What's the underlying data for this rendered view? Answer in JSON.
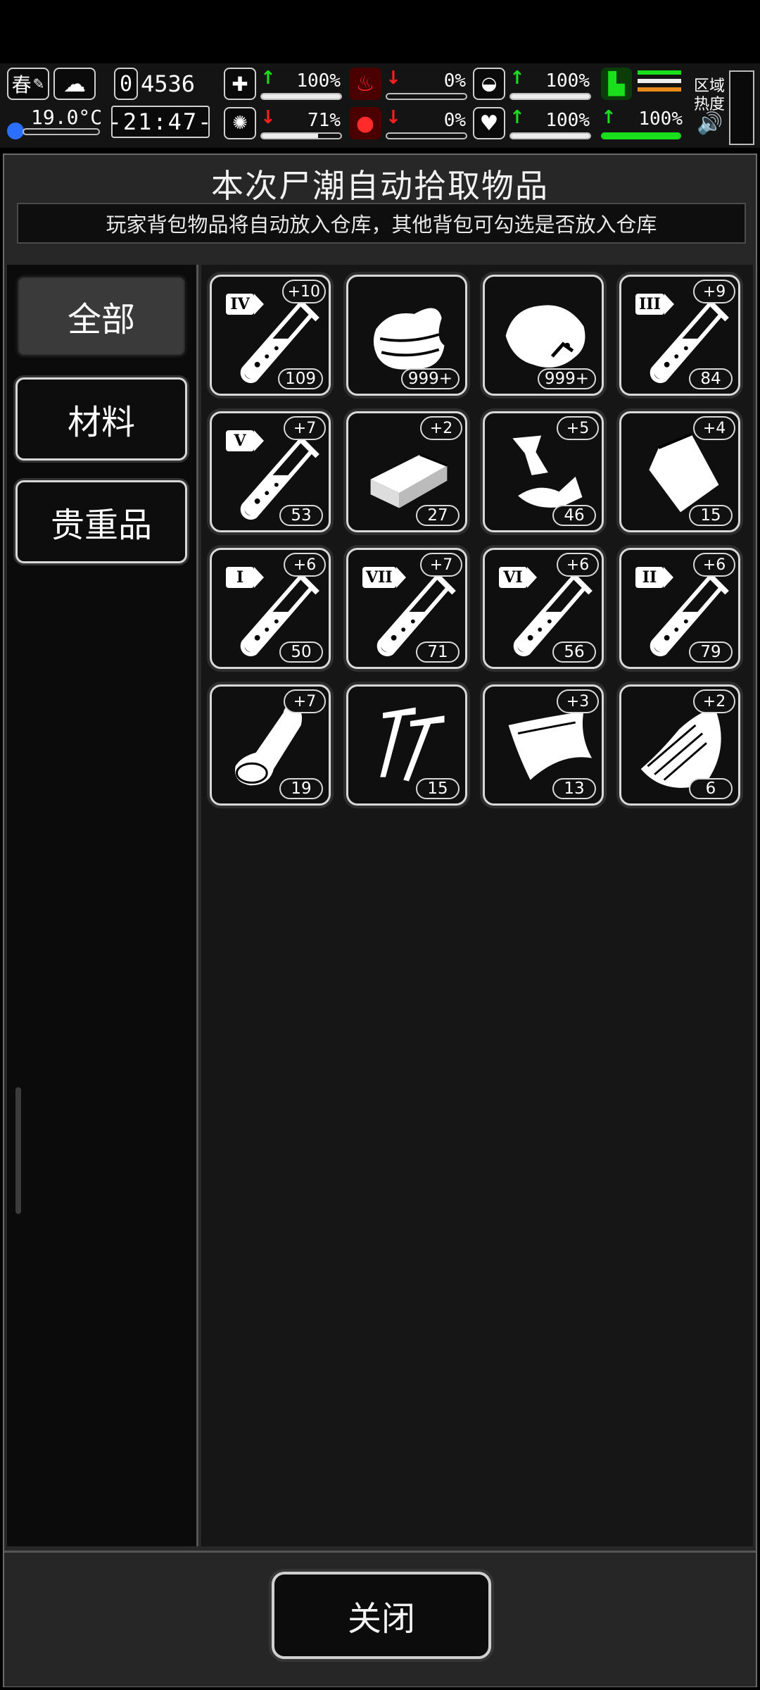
{
  "hud": {
    "season": "春",
    "temperature": "19.0°C",
    "day_counter": "4536",
    "day_digit": "0",
    "clock": "-21:47-",
    "region_heat_label_1": "区域",
    "region_heat_label_2": "热度",
    "stats": [
      {
        "icon": "medkit-icon",
        "trend": "up",
        "value": "100%"
      },
      {
        "icon": "stomach-icon",
        "trend": "down",
        "value": "0%"
      },
      {
        "icon": "pill-icon",
        "trend": "up",
        "value": "100%"
      },
      {
        "icon": "brain-icon",
        "trend": "down",
        "value": "71%"
      },
      {
        "icon": "blood-drop-icon",
        "trend": "down",
        "value": "0%"
      },
      {
        "icon": "heart-icon",
        "trend": "up",
        "value": "100%"
      },
      {
        "icon": "stamina-icon",
        "trend": "up",
        "value": "100%"
      }
    ],
    "colors": {
      "accent_green": "#19e01b",
      "accent_red": "#ff2020",
      "orange": "#e98a1d"
    }
  },
  "panel": {
    "title": "本次尸潮自动拾取物品",
    "subtitle": "玩家背包物品将自动放入仓库，其他背包可勾选是否放入仓库"
  },
  "tabs": [
    {
      "label": "全部",
      "active": true
    },
    {
      "label": "材料",
      "active": false
    },
    {
      "label": "贵重品",
      "active": false
    }
  ],
  "items": [
    {
      "icon": "test-tube-icon",
      "tier": "IV",
      "bonus": "+10",
      "count": "109"
    },
    {
      "icon": "cloth-icon",
      "tier": "",
      "bonus": "",
      "count": "999+"
    },
    {
      "icon": "rock-icon",
      "tier": "",
      "bonus": "",
      "count": "999+"
    },
    {
      "icon": "test-tube-icon",
      "tier": "III",
      "bonus": "+9",
      "count": "84"
    },
    {
      "icon": "test-tube-icon",
      "tier": "V",
      "bonus": "+7",
      "count": "53"
    },
    {
      "icon": "wood-block-icon",
      "tier": "",
      "bonus": "+2",
      "count": "27"
    },
    {
      "icon": "metal-scrap-icon",
      "tier": "",
      "bonus": "+5",
      "count": "46"
    },
    {
      "icon": "bag-icon",
      "tier": "",
      "bonus": "+4",
      "count": "15"
    },
    {
      "icon": "test-tube-icon",
      "tier": "I",
      "bonus": "+6",
      "count": "50"
    },
    {
      "icon": "test-tube-icon",
      "tier": "VII",
      "bonus": "+7",
      "count": "71"
    },
    {
      "icon": "test-tube-icon",
      "tier": "VI",
      "bonus": "+6",
      "count": "56"
    },
    {
      "icon": "test-tube-icon",
      "tier": "II",
      "bonus": "+6",
      "count": "79"
    },
    {
      "icon": "bone-icon",
      "tier": "",
      "bonus": "+7",
      "count": "19"
    },
    {
      "icon": "screws-icon",
      "tier": "",
      "bonus": "",
      "count": "15"
    },
    {
      "icon": "leather-icon",
      "tier": "",
      "bonus": "+3",
      "count": "13"
    },
    {
      "icon": "fur-icon",
      "tier": "",
      "bonus": "+2",
      "count": "6"
    }
  ],
  "footer": {
    "close_label": "关闭"
  }
}
